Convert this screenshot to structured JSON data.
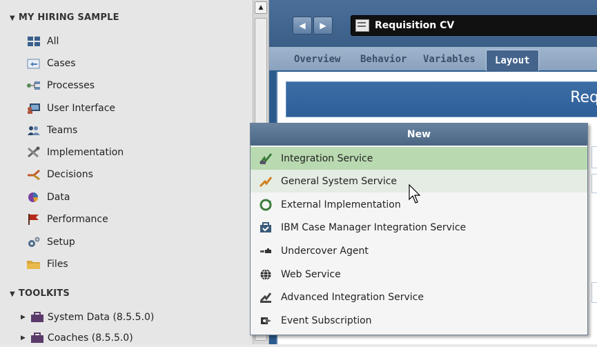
{
  "library": {
    "project_title": "MY HIRING SAMPLE",
    "items": [
      {
        "label": "All",
        "icon": "grid-icon"
      },
      {
        "label": "Cases",
        "icon": "cases-icon"
      },
      {
        "label": "Processes",
        "icon": "processes-icon"
      },
      {
        "label": "User Interface",
        "icon": "user-interface-icon"
      },
      {
        "label": "Teams",
        "icon": "teams-icon"
      },
      {
        "label": "Implementation",
        "icon": "implementation-icon"
      },
      {
        "label": "Decisions",
        "icon": "decisions-icon"
      },
      {
        "label": "Data",
        "icon": "data-icon"
      },
      {
        "label": "Performance",
        "icon": "flag-icon"
      },
      {
        "label": "Setup",
        "icon": "gears-icon"
      },
      {
        "label": "Files",
        "icon": "folder-icon"
      }
    ],
    "toolkits_title": "TOOLKITS",
    "toolkits": [
      {
        "label": "System Data (8.5.5.0)"
      },
      {
        "label": "Coaches (8.5.5.0)"
      }
    ]
  },
  "editor": {
    "title": "Requisition CV",
    "tabs": [
      "Overview",
      "Behavior",
      "Variables",
      "Layout"
    ],
    "active_tab": "Layout",
    "banner_text": "Req"
  },
  "popup": {
    "title": "New",
    "items": [
      {
        "label": "Integration Service",
        "icon": "integration-service-icon"
      },
      {
        "label": "General System Service",
        "icon": "general-system-service-icon"
      },
      {
        "label": "External Implementation",
        "icon": "external-implementation-icon"
      },
      {
        "label": "IBM Case Manager Integration Service",
        "icon": "case-manager-icon"
      },
      {
        "label": "Undercover Agent",
        "icon": "undercover-agent-icon"
      },
      {
        "label": "Web Service",
        "icon": "globe-icon"
      },
      {
        "label": "Advanced Integration Service",
        "icon": "advanced-integration-icon"
      },
      {
        "label": "Event Subscription",
        "icon": "event-subscription-icon"
      }
    ]
  },
  "colors": {
    "highlight": "#b9d9b0",
    "header_blue": "#4a6683",
    "editor_blue": "#2b5b8c"
  }
}
